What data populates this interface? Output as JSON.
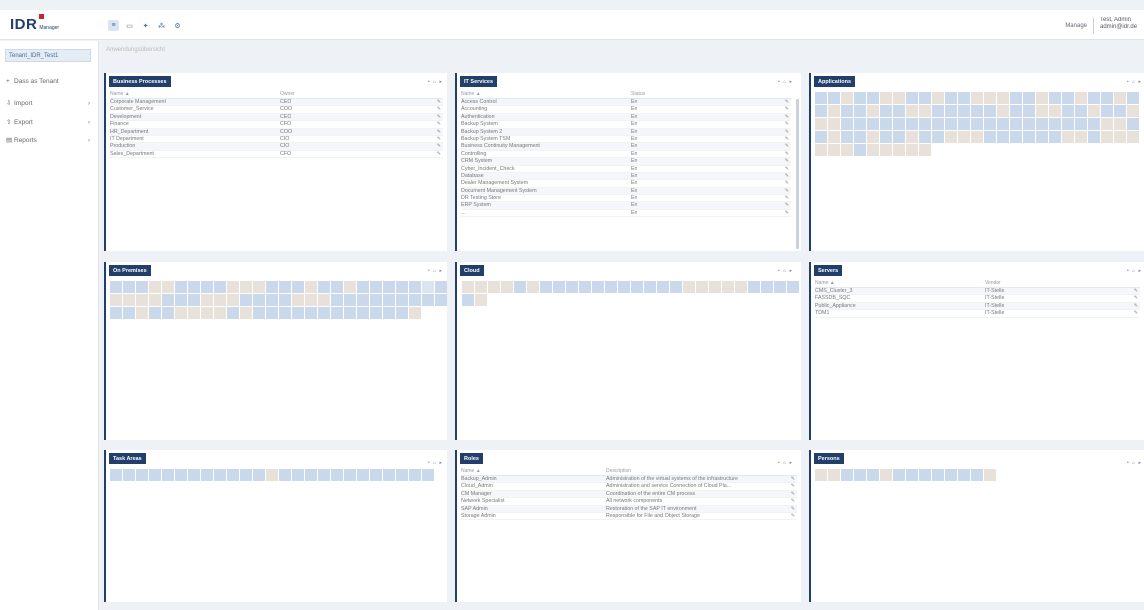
{
  "app": {
    "logo": "IDR",
    "logo_sub": "Manager"
  },
  "toolbar": {
    "icons": [
      "list-view-icon",
      "table-view-icon",
      "tree-view-icon",
      "network-view-icon",
      "settings-icon"
    ]
  },
  "header": {
    "manage": "Manage",
    "user_line1": "Test, Admin",
    "user_line2": "admin@idr.de"
  },
  "sidebar": {
    "tenant": "Tenant_IDR_Test1",
    "items": [
      {
        "label": "Dass as Tenant",
        "icon": "+",
        "chev": ""
      },
      {
        "label": "Import",
        "icon": "⇩",
        "chev": "›"
      },
      {
        "label": "Export",
        "icon": "⇧",
        "chev": "›"
      },
      {
        "label": "Reports",
        "icon": "▤",
        "chev": "›"
      }
    ]
  },
  "breadcrumb": "Anwendungsübersicht",
  "panels": {
    "business_processes": {
      "title": "Business Processes",
      "col1": "Name ▲",
      "col2": "Owner",
      "rows": [
        [
          "Corporate Management",
          "CEO"
        ],
        [
          "Customer_Service",
          "COO"
        ],
        [
          "Development",
          "CEO"
        ],
        [
          "Finance",
          "CFO"
        ],
        [
          "HR_Department",
          "COO"
        ],
        [
          "IT Department",
          "CIO"
        ],
        [
          "Production",
          "CIO"
        ],
        [
          "Sales_Department",
          "CFO"
        ]
      ]
    },
    "it_services": {
      "title": "IT Services",
      "col1": "Name ▲",
      "col2": "Status",
      "rows": [
        [
          "Access Control",
          "En"
        ],
        [
          "Accounting",
          "En"
        ],
        [
          "Authentication",
          "En"
        ],
        [
          "Backup System",
          "En"
        ],
        [
          "Backup System 2",
          "En"
        ],
        [
          "Backup System TSM",
          "En"
        ],
        [
          "Business Continuity Management",
          "En"
        ],
        [
          "Controlling",
          "En"
        ],
        [
          "CRM System",
          "En"
        ],
        [
          "Cyber_Incident_Check",
          "En"
        ],
        [
          "Database",
          "En"
        ],
        [
          "Dealer Management System",
          "En"
        ],
        [
          "Document Management System",
          "En"
        ],
        [
          "DR Testing Store",
          "En"
        ],
        [
          "ERP System",
          "En"
        ],
        [
          "…",
          "En"
        ]
      ]
    },
    "applications": {
      "title": "Applications"
    },
    "on_premises": {
      "title": "On Premises"
    },
    "cloud": {
      "title": "Cloud"
    },
    "servers": {
      "title": "Servers",
      "col1": "Name ▲",
      "col2": "Vendor",
      "rows": [
        [
          "CMS_Cluster_3",
          "IT-Stelle"
        ],
        [
          "FASSDB_SQC",
          "IT-Stelle"
        ],
        [
          "Public_Appliance",
          "IT-Stelle"
        ],
        [
          "TDM1",
          "IT-Stelle"
        ]
      ]
    },
    "task_areas": {
      "title": "Task Areas"
    },
    "roles": {
      "title": "Roles",
      "col1": "Name ▲",
      "col2": "Description",
      "rows": [
        [
          "Backup_Admin",
          "Administration of the virtual systems of the infrastructure"
        ],
        [
          "Cloud_Admin",
          "Administration and service Connection of Cloud Pla..."
        ],
        [
          "CM Manager",
          "Coordination of the entire CM process"
        ],
        [
          "Network Specialist",
          "All network components"
        ],
        [
          "SAP Admin",
          "Restoration of the SAP IT environment"
        ],
        [
          "Storage Admin",
          "Responsible for File and Object Storage"
        ]
      ]
    },
    "persons": {
      "title": "Persons"
    },
    "controls": "• ⌂ ▸"
  },
  "tile_colors": {
    "a": "#c9d8ea",
    "b": "#e7e1d9",
    "c": "#dbe5f1"
  }
}
